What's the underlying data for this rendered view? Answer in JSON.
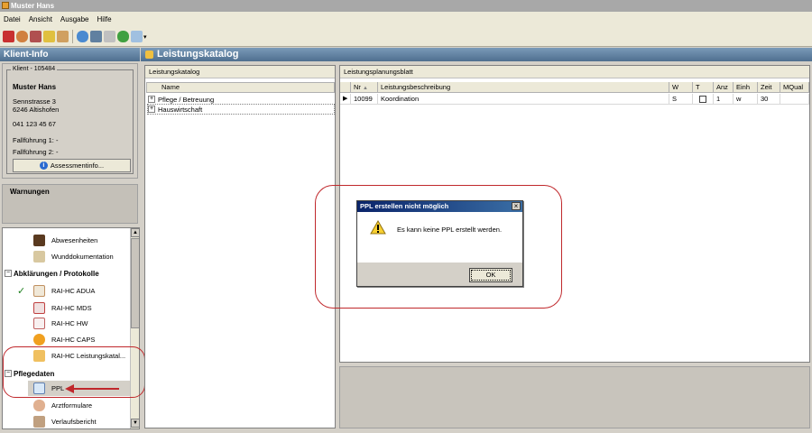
{
  "window": {
    "title": "Muster Hans"
  },
  "menu": {
    "items": [
      "Datei",
      "Ansicht",
      "Ausgabe",
      "Hilfe"
    ]
  },
  "toolbar": {
    "icons": [
      "book-red-icon",
      "person-icon",
      "form-icon",
      "folder-icon",
      "document-icon",
      "refresh-icon",
      "save-icon",
      "lock-icon",
      "arrows-icon",
      "print-preview-icon"
    ]
  },
  "klient": {
    "header": "Klient-Info",
    "legend": "Klient - 105484",
    "name": "Muster Hans",
    "address1": "Sennstrasse 3",
    "address2": "6246 Altishofen",
    "phone": "041 123 45 67",
    "fallfuehrung1": "Fallführung 1: -",
    "fallfuehrung2": "Fallführung 2: -",
    "assessment_button": "Assessmentinfo..."
  },
  "warnungen": {
    "title": "Warnungen"
  },
  "nav": {
    "items_top": [
      {
        "label": "Abwesenheiten",
        "icon": "door-icon"
      },
      {
        "label": "Wunddokumentation",
        "icon": "bandage-icon"
      }
    ],
    "group1": "Abklärungen / Protokolle",
    "group1_items": [
      {
        "label": "RAI-HC ADUA",
        "icon": "pencil-doc-icon"
      },
      {
        "label": "RAI-HC MDS",
        "icon": "stop-doc-icon"
      },
      {
        "label": "RAI-HC HW",
        "icon": "up-doc-icon"
      },
      {
        "label": "RAI-HC CAPS",
        "icon": "exclamation-icon"
      },
      {
        "label": "RAI-HC Leistungskatal...",
        "icon": "catalog-icon"
      }
    ],
    "group2": "Pflegedaten",
    "group2_items": [
      {
        "label": "PPL",
        "icon": "ppl-clock-icon"
      },
      {
        "label": "Arztformulare",
        "icon": "doctor-icon"
      },
      {
        "label": "Verlaufsbericht",
        "icon": "report-icon"
      }
    ]
  },
  "main": {
    "header": "Leistungskatalog"
  },
  "katalog": {
    "title": "Leistungskatalog",
    "column": "Name",
    "rows": [
      "Pflege / Betreuung",
      "Hauswirtschaft"
    ]
  },
  "plan": {
    "title": "Leistungsplanungsblatt",
    "columns": [
      "Nr",
      "Leistungsbeschreibung",
      "W",
      "T",
      "Anz",
      "Einh",
      "Zeit",
      "MQual"
    ],
    "row": {
      "nr": "10099",
      "beschreibung": "Koordination",
      "w": "S",
      "t": false,
      "anz": "1",
      "einh": "w",
      "zeit": "30",
      "mqual": ""
    }
  },
  "dialog": {
    "title": "PPL erstellen nicht möglich",
    "message": "Es kann keine PPL erstellt werden.",
    "ok": "OK"
  },
  "colors": {
    "annotation": "#c0282c",
    "header_blue": "#4f6f8f",
    "dialog_title": "#0a246a"
  }
}
